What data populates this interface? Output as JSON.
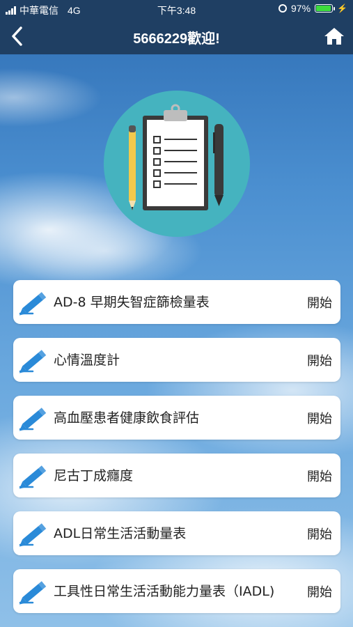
{
  "status_bar": {
    "carrier": "中華電信",
    "network": "4G",
    "time": "下午3:48",
    "battery": "97%",
    "battery_level": 0.97,
    "battery_color": "#3ddc3d"
  },
  "nav": {
    "title": "5666229歡迎!",
    "back_icon": "chevron-left-icon",
    "home_icon": "home-icon",
    "bar_color": "#1f3f63"
  },
  "hero": {
    "icon": "clipboard-checklist-icon",
    "circle_color": "#45b3bf"
  },
  "items": [
    {
      "label": "AD-8 早期失智症篩檢量表",
      "action": "開始"
    },
    {
      "label": "心情溫度計",
      "action": "開始"
    },
    {
      "label": "高血壓患者健康飲食評估",
      "action": "開始"
    },
    {
      "label": "尼古丁成癮度",
      "action": "開始"
    },
    {
      "label": "ADL日常生活活動量表",
      "action": "開始"
    },
    {
      "label": "工具性日常生活活動能力量表（IADL)",
      "action": "開始"
    }
  ],
  "accent_color": "#2a8ad8"
}
